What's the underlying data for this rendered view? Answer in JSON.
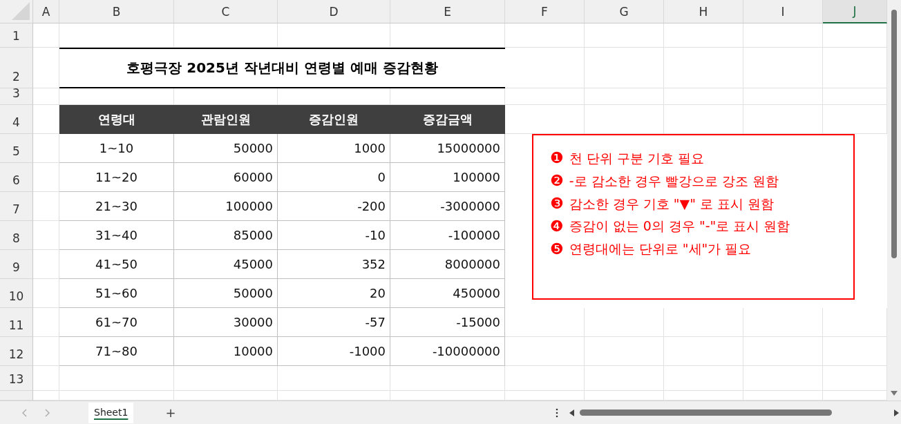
{
  "columns": [
    {
      "label": "A",
      "selected": false
    },
    {
      "label": "B",
      "selected": false
    },
    {
      "label": "C",
      "selected": false
    },
    {
      "label": "D",
      "selected": false
    },
    {
      "label": "E",
      "selected": false
    },
    {
      "label": "F",
      "selected": false
    },
    {
      "label": "G",
      "selected": false
    },
    {
      "label": "H",
      "selected": false
    },
    {
      "label": "I",
      "selected": false
    },
    {
      "label": "J",
      "selected": true
    }
  ],
  "row_numbers": [
    "1",
    "2",
    "3",
    "4",
    "5",
    "6",
    "7",
    "8",
    "9",
    "10",
    "11",
    "12",
    "13"
  ],
  "title": "호평극장 2025년 작년대비 연령별 예매 증감현황",
  "table": {
    "columns": [
      "연령대",
      "관람인원",
      "증감인원",
      "증감금액"
    ],
    "rows": [
      [
        "1~10",
        "50000",
        "1000",
        "15000000"
      ],
      [
        "11~20",
        "60000",
        "0",
        "100000"
      ],
      [
        "21~30",
        "100000",
        "-200",
        "-3000000"
      ],
      [
        "31~40",
        "85000",
        "-10",
        "-100000"
      ],
      [
        "41~50",
        "45000",
        "352",
        "8000000"
      ],
      [
        "51~60",
        "50000",
        "20",
        "450000"
      ],
      [
        "61~70",
        "30000",
        "-57",
        "-15000"
      ],
      [
        "71~80",
        "10000",
        "-1000",
        "-10000000"
      ]
    ]
  },
  "notes": [
    {
      "marker": "❶",
      "text": "천 단위 구분 기호 필요"
    },
    {
      "marker": "❷",
      "text": "-로 감소한 경우 빨강으로 강조 원함"
    },
    {
      "marker": "❸",
      "text": "감소한 경우 기호 \"▼\" 로 표시 원함"
    },
    {
      "marker": "❹",
      "text": "증감이 없는 0의 경우 \"-\"로 표시 원함"
    },
    {
      "marker": "❺",
      "text": "연령대에는 단위로 \"세\"가 필요"
    }
  ],
  "sheet_tabs": [
    {
      "label": "Sheet1",
      "selected": true
    }
  ],
  "add_sheet": "+"
}
